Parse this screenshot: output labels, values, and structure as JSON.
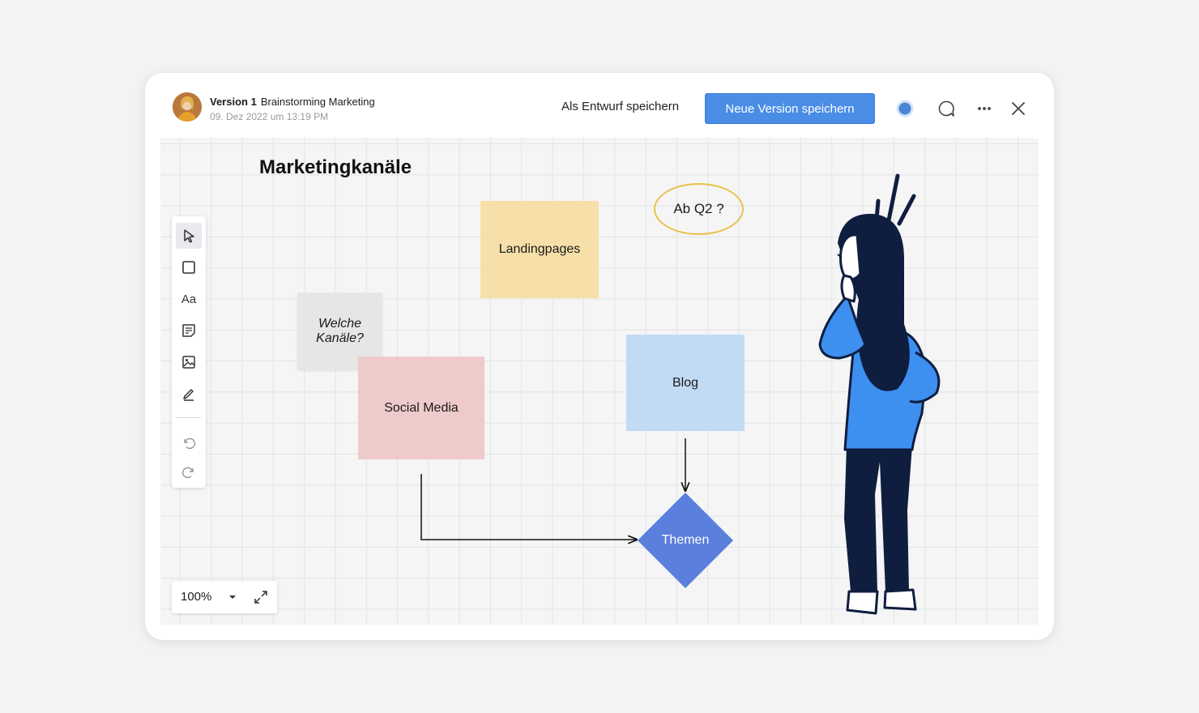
{
  "header": {
    "version_label": "Version 1",
    "board_name": "Brainstorming Marketing",
    "timestamp": "09. Dez 2022 um 13:19 PM",
    "draft_button": "Als Entwurf speichern",
    "save_version_button": "Neue Version speichern",
    "icons": [
      "status-dot-icon",
      "comment-icon",
      "more-icon",
      "close-icon"
    ]
  },
  "board": {
    "title": "Marketingkanäle",
    "stickies": {
      "landingpages": "Landingpages",
      "welche": "Welche Kanäle?",
      "social_media": "Social Media",
      "blog": "Blog"
    },
    "callout": "Ab Q2 ?",
    "diamond": "Themen"
  },
  "toolbar": {
    "tools": [
      "select-icon",
      "rectangle-icon",
      "text-icon",
      "sticky-note-icon",
      "image-icon",
      "pen-icon",
      "undo-icon",
      "redo-icon"
    ],
    "text_tool_label": "Aa"
  },
  "zoom": {
    "level": "100%"
  },
  "colors": {
    "accent": "#4a8de6",
    "sticky_yellow": "#f7dfa9",
    "sticky_grey": "#e6e6e6",
    "sticky_pink": "#efcaca",
    "sticky_blue": "#c1dbf5",
    "diamond": "#5b7fdd",
    "figure_navy": "#0f1e3f",
    "figure_blue": "#3d8ff0"
  }
}
